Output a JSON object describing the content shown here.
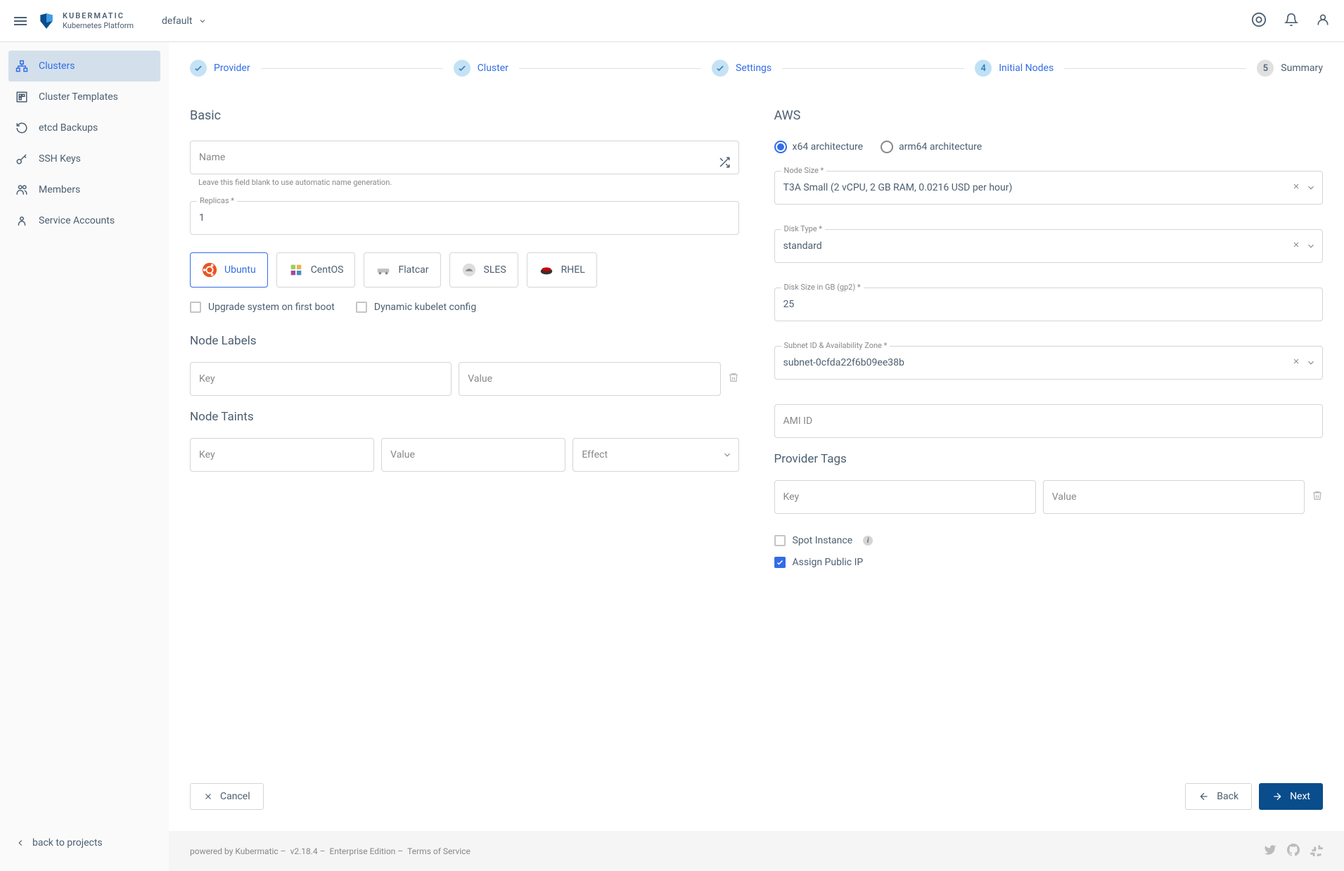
{
  "header": {
    "brand_line1": "KUBERMATIC",
    "brand_line2": "Kubernetes Platform",
    "project": "default"
  },
  "sidebar": {
    "items": [
      {
        "label": "Clusters"
      },
      {
        "label": "Cluster Templates"
      },
      {
        "label": "etcd Backups"
      },
      {
        "label": "SSH Keys"
      },
      {
        "label": "Members"
      },
      {
        "label": "Service Accounts"
      }
    ],
    "back": "back to projects"
  },
  "stepper": [
    {
      "label": "Provider"
    },
    {
      "label": "Cluster"
    },
    {
      "label": "Settings"
    },
    {
      "num": "4",
      "label": "Initial Nodes"
    },
    {
      "num": "5",
      "label": "Summary"
    }
  ],
  "basic": {
    "heading": "Basic",
    "name_placeholder": "Name",
    "name_helper": "Leave this field blank to use automatic name generation.",
    "replicas_label": "Replicas *",
    "replicas_value": "1",
    "os": [
      "Ubuntu",
      "CentOS",
      "Flatcar",
      "SLES",
      "RHEL"
    ],
    "upgrade_label": "Upgrade system on first boot",
    "dynamic_label": "Dynamic kubelet config",
    "labels_heading": "Node Labels",
    "key_placeholder": "Key",
    "value_placeholder": "Value",
    "taints_heading": "Node Taints",
    "effect_placeholder": "Effect"
  },
  "aws": {
    "heading": "AWS",
    "arch_x64": "x64 architecture",
    "arch_arm64": "arm64 architecture",
    "size_label": "Node Size *",
    "size_value": "T3A Small (2 vCPU, 2 GB RAM, 0.0216 USD per hour)",
    "disktype_label": "Disk Type *",
    "disktype_value": "standard",
    "disksize_label": "Disk Size in GB (gp2) *",
    "disksize_value": "25",
    "subnet_label": "Subnet ID & Availability Zone *",
    "subnet_value": "subnet-0cfda22f6b09ee38b",
    "ami_placeholder": "AMI ID",
    "tags_heading": "Provider Tags",
    "spot_label": "Spot Instance",
    "public_ip_label": "Assign Public IP"
  },
  "buttons": {
    "cancel": "Cancel",
    "back": "Back",
    "next": "Next"
  },
  "footer": {
    "powered": "powered by Kubermatic  –",
    "version": "v2.18.4  –",
    "edition": "Enterprise Edition  –",
    "tos": "Terms of Service"
  }
}
